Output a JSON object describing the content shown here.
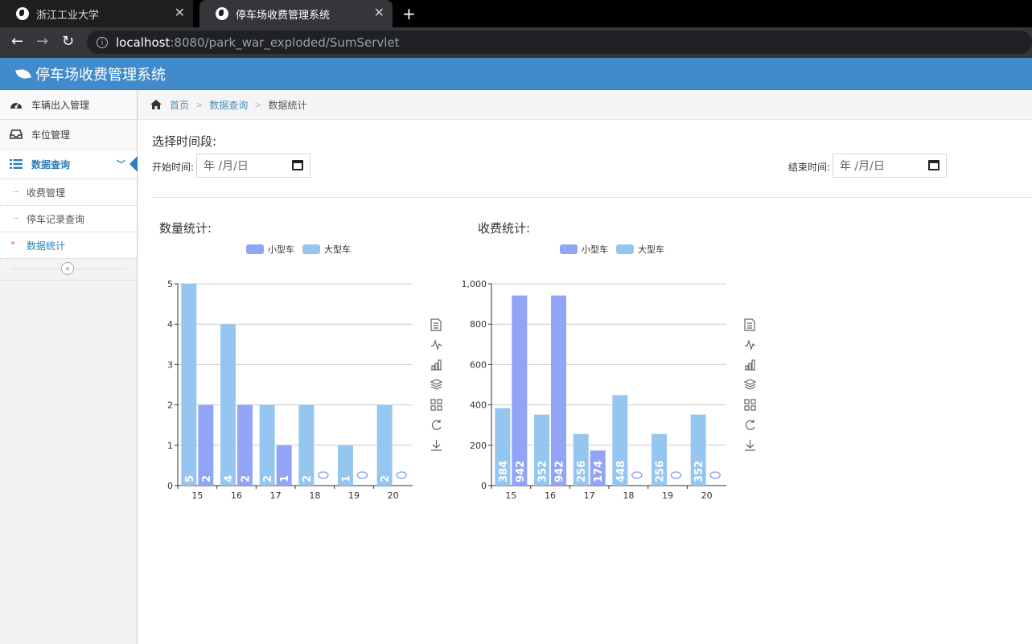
{
  "browser": {
    "tabs": [
      {
        "title": "浙江工业大学",
        "active": false
      },
      {
        "title": "停车场收费管理系统",
        "active": true
      }
    ],
    "url_host": "localhost",
    "url_rest": ":8080/park_war_exploded/SumServlet"
  },
  "app": {
    "title": "停车场收费管理系统"
  },
  "sidebar": {
    "items": [
      {
        "label": "车辆出入管理",
        "icon": "dashboard-icon"
      },
      {
        "label": "车位管理",
        "icon": "inbox-icon"
      },
      {
        "label": "数据查询",
        "icon": "list-icon",
        "active": true
      }
    ],
    "subitems": [
      {
        "label": "收费管理"
      },
      {
        "label": "停车记录查询"
      },
      {
        "label": "数据统计",
        "active": true
      }
    ]
  },
  "breadcrumb": {
    "home": "首页",
    "parent": "数据查询",
    "current": "数据统计"
  },
  "filters": {
    "heading": "选择时间段:",
    "start_label": "开始时间:",
    "end_label": "结束时间:",
    "date_placeholder": "年 /月/日"
  },
  "colors": {
    "small": "#91a4f6",
    "large": "#95c6ef"
  },
  "chart_data": [
    {
      "type": "bar",
      "title": "数量统计:",
      "categories": [
        "15",
        "16",
        "17",
        "18",
        "19",
        "20"
      ],
      "ylim": [
        0,
        5
      ],
      "yticks": [
        "0",
        "1",
        "2",
        "3",
        "4",
        "5"
      ],
      "legend": "top-center",
      "series": [
        {
          "name": "大型车",
          "values": [
            5,
            4,
            2,
            2,
            1,
            2
          ]
        },
        {
          "name": "小型车",
          "values": [
            2,
            2,
            1,
            null,
            null,
            null
          ]
        }
      ]
    },
    {
      "type": "bar",
      "title": "收费统计:",
      "categories": [
        "15",
        "16",
        "17",
        "18",
        "19",
        "20"
      ],
      "ylim": [
        0,
        1000
      ],
      "yticks": [
        "0",
        "200",
        "400",
        "600",
        "800",
        "1,000"
      ],
      "legend": "top-center",
      "series": [
        {
          "name": "大型车",
          "values": [
            384,
            352,
            256,
            448,
            256,
            352
          ]
        },
        {
          "name": "小型车",
          "values": [
            942,
            942,
            174,
            null,
            null,
            null
          ]
        }
      ]
    }
  ]
}
